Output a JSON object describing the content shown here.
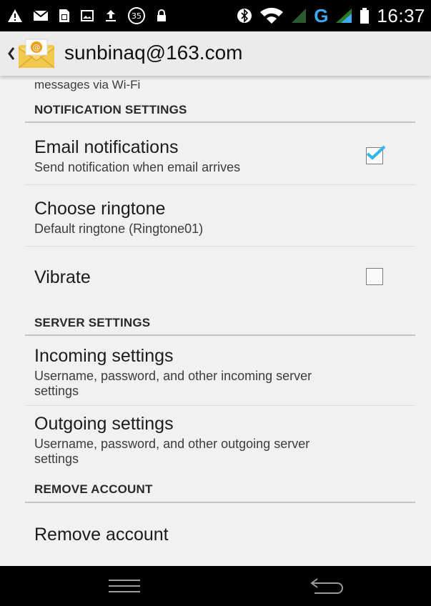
{
  "status_bar": {
    "time": "16:37",
    "notification_badge": "35",
    "network_type": "G",
    "icons": [
      "warning-icon",
      "mail-icon",
      "sim-icon",
      "image-icon",
      "upload-icon",
      "badge-icon",
      "lock-icon",
      "bluetooth-icon",
      "wifi-icon",
      "signal-weak-icon",
      "signal-icon",
      "battery-icon"
    ]
  },
  "action_bar": {
    "title": "sunbinaq@163.com",
    "icon": "email-app-icon"
  },
  "content": {
    "partial_text": "messages via Wi-Fi",
    "sections": {
      "notification": {
        "header": "NOTIFICATION SETTINGS"
      },
      "server": {
        "header": "SERVER SETTINGS"
      },
      "remove": {
        "header": "REMOVE ACCOUNT"
      }
    },
    "items": {
      "email_notifications": {
        "title": "Email notifications",
        "summary": "Send notification when email arrives",
        "checked": true
      },
      "ringtone": {
        "title": "Choose ringtone",
        "summary": "Default ringtone (Ringtone01)"
      },
      "vibrate": {
        "title": "Vibrate",
        "checked": false
      },
      "incoming": {
        "title": "Incoming settings",
        "summary_line1": "Username, password, and other incoming server",
        "summary_line2": "settings"
      },
      "outgoing": {
        "title": "Outgoing settings",
        "summary_line1": "Username, password, and other outgoing server",
        "summary_line2": "settings"
      },
      "remove_account": {
        "title": "Remove account"
      }
    }
  },
  "colors": {
    "background": "#f1f1f1",
    "checkmark": "#33b5e5",
    "section_line": "#c4c4c4"
  },
  "nav_bar": {
    "icons": [
      "menu-icon",
      "back-icon"
    ]
  }
}
